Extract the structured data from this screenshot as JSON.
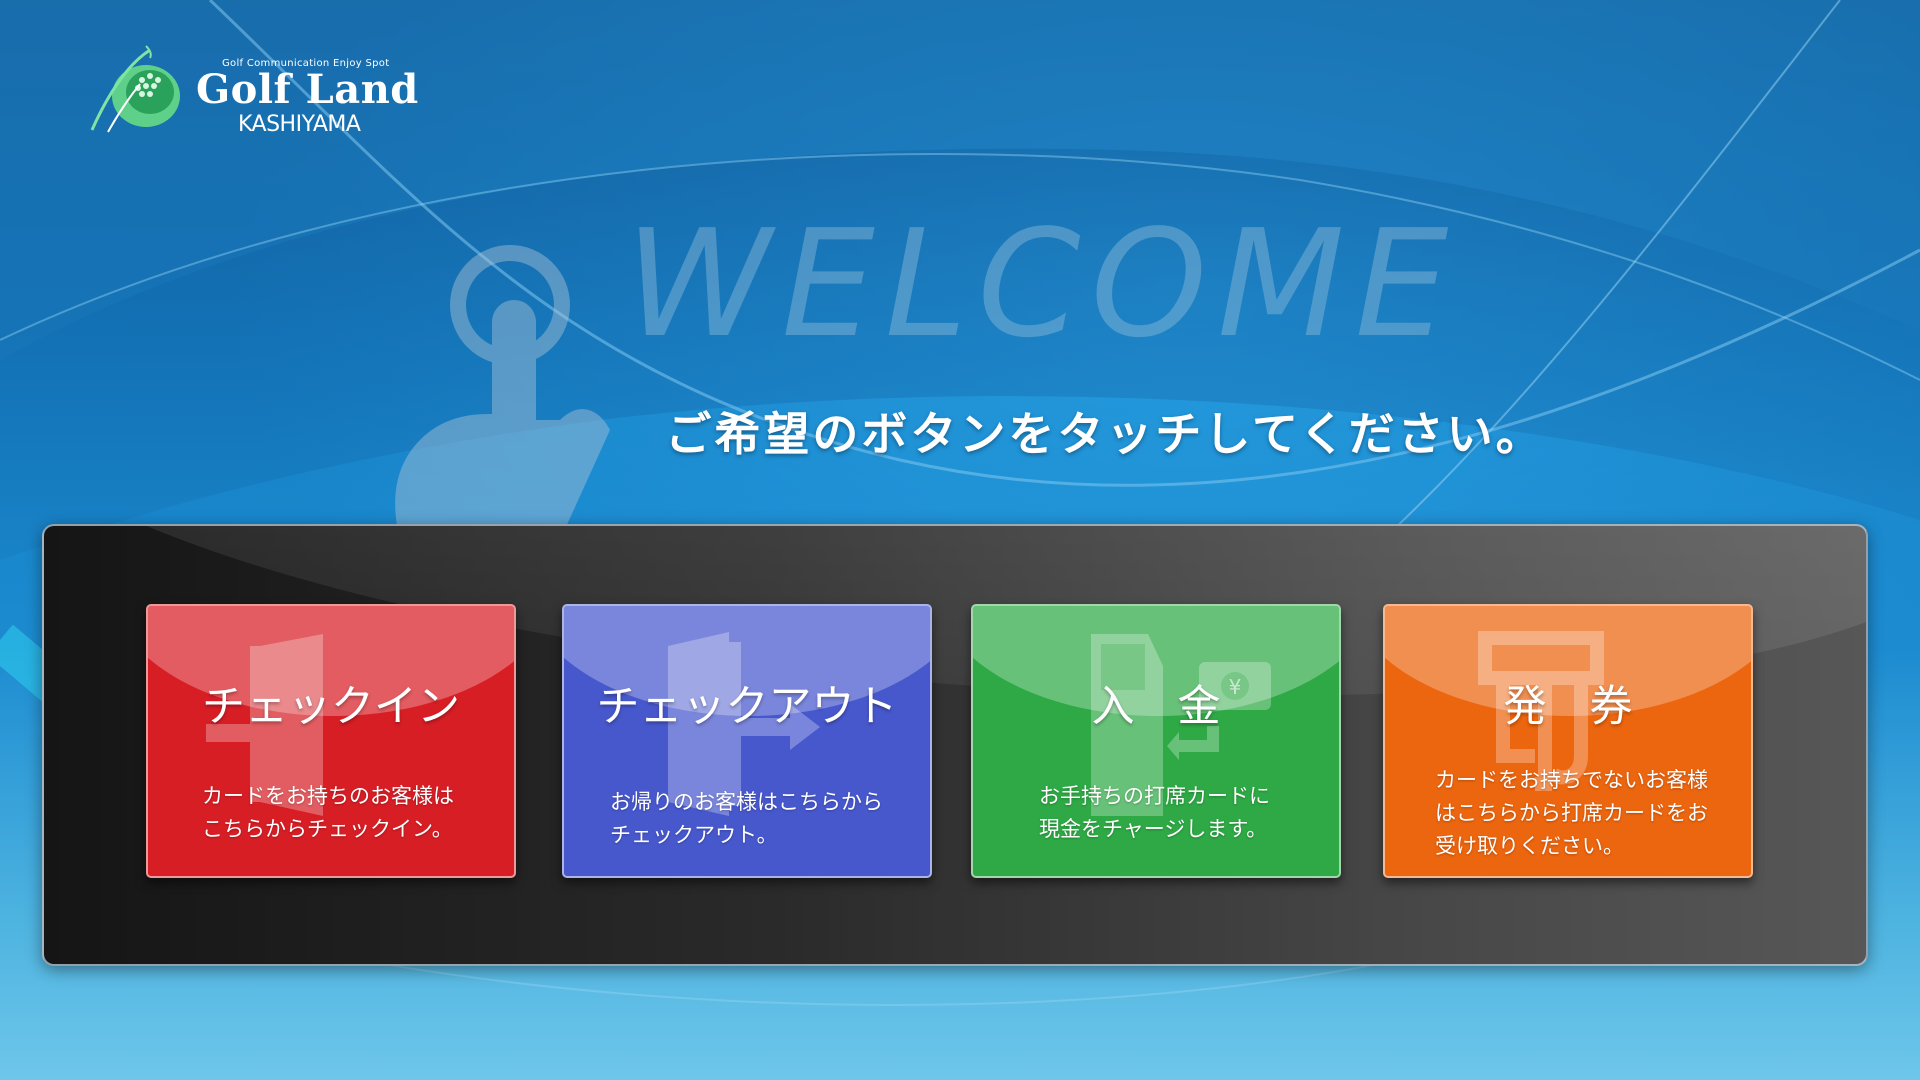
{
  "logo": {
    "tagline": "Golf Communication Enjoy Spot",
    "brand": "Golf Land",
    "sub": "KASHIYAMA"
  },
  "welcome": "WELCOME",
  "instruction": "ご希望のボタンをタッチしてください。",
  "buttons": [
    {
      "title": "チェックイン",
      "desc": "カードをお持ちのお客様は\nこちらからチェックイン。",
      "color": "#d71e25",
      "icon": "door-enter-icon"
    },
    {
      "title": "チェックアウト",
      "desc": "お帰りのお客様はこちらから\nチェックアウト。",
      "color": "#4758cd",
      "icon": "door-exit-icon"
    },
    {
      "title": "入　金",
      "desc": "お手持ちの打席カードに\n現金をチャージします。",
      "color": "#2ea945",
      "icon": "kiosk-cash-icon"
    },
    {
      "title": "発　券",
      "desc": "カードをお持ちでないお客様\nはこちらから打席カードをお\n受け取りください。",
      "color": "#ec650f",
      "icon": "ticket-dispenser-icon"
    }
  ]
}
